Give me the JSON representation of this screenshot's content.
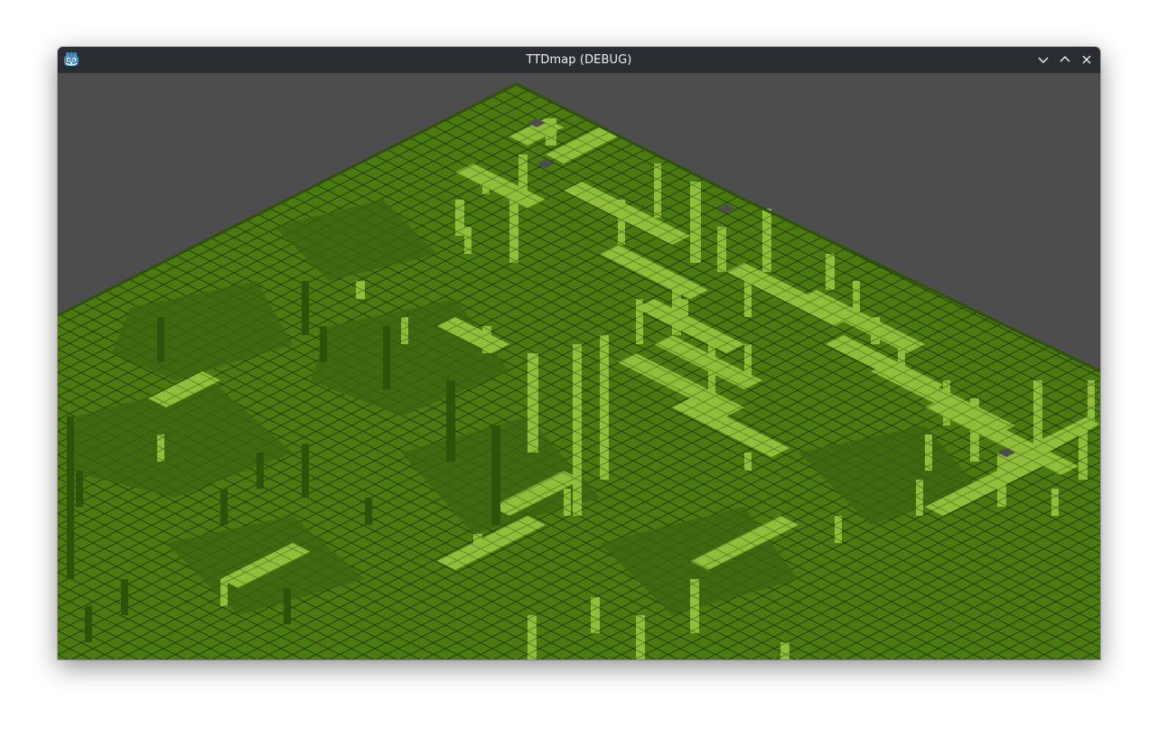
{
  "window": {
    "title": "TTDmap (DEBUG)",
    "app_icon": "godot-engine-icon",
    "controls": [
      "minimize-icon",
      "maximize-icon",
      "close-icon"
    ]
  },
  "viewport": {
    "content": "isometric-terrain-map",
    "colors": {
      "background": "#4d4d4e",
      "terrain_top": "#4a7a10",
      "terrain_dark": "#3b6410",
      "cliff_light": "#8fbf3a",
      "cliff_shadow": "#2e5209",
      "grid_line": "#1a2e06",
      "titlebar": "#2a2e32"
    }
  }
}
